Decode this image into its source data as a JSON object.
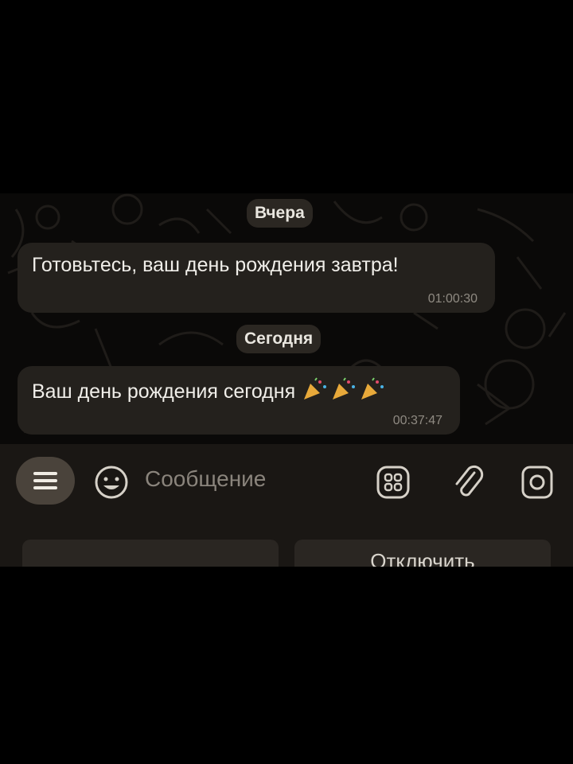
{
  "chat": {
    "date_chips": [
      "Вчера",
      "Сегодня"
    ],
    "messages": [
      {
        "text": "Готовьтесь, ваш день рождения завтра!",
        "time": "01:00:30"
      },
      {
        "text": "Ваш день рождения сегодня",
        "emoji": "party-popper x3",
        "time": "00:37:47"
      }
    ]
  },
  "input": {
    "placeholder": "Сообщение",
    "icons": [
      "menu-icon",
      "emoji-icon",
      "sticker-grid-icon",
      "attach-icon",
      "camera-icon"
    ]
  },
  "bottom_buttons": [
    "",
    "Отключить"
  ],
  "colors": {
    "background": "#000000",
    "chat_background": "#0a0908",
    "bubble": "#24211d",
    "input_bar": "#1a1714",
    "menu_button": "#4a433b"
  }
}
